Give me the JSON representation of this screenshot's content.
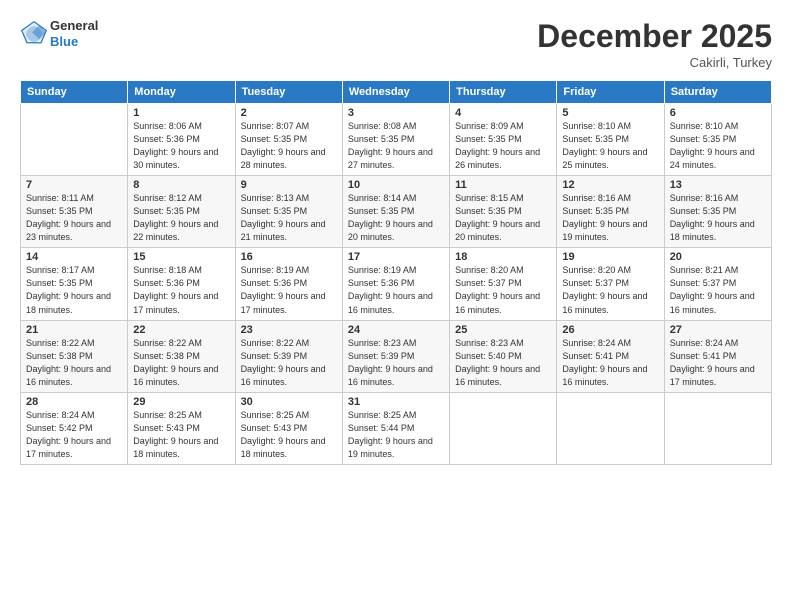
{
  "logo": {
    "general": "General",
    "blue": "Blue"
  },
  "header": {
    "month_year": "December 2025",
    "location": "Cakirli, Turkey"
  },
  "weekdays": [
    "Sunday",
    "Monday",
    "Tuesday",
    "Wednesday",
    "Thursday",
    "Friday",
    "Saturday"
  ],
  "weeks": [
    [
      {
        "day": "",
        "sunrise": "",
        "sunset": "",
        "daylight": ""
      },
      {
        "day": "1",
        "sunrise": "Sunrise: 8:06 AM",
        "sunset": "Sunset: 5:36 PM",
        "daylight": "Daylight: 9 hours and 30 minutes."
      },
      {
        "day": "2",
        "sunrise": "Sunrise: 8:07 AM",
        "sunset": "Sunset: 5:35 PM",
        "daylight": "Daylight: 9 hours and 28 minutes."
      },
      {
        "day": "3",
        "sunrise": "Sunrise: 8:08 AM",
        "sunset": "Sunset: 5:35 PM",
        "daylight": "Daylight: 9 hours and 27 minutes."
      },
      {
        "day": "4",
        "sunrise": "Sunrise: 8:09 AM",
        "sunset": "Sunset: 5:35 PM",
        "daylight": "Daylight: 9 hours and 26 minutes."
      },
      {
        "day": "5",
        "sunrise": "Sunrise: 8:10 AM",
        "sunset": "Sunset: 5:35 PM",
        "daylight": "Daylight: 9 hours and 25 minutes."
      },
      {
        "day": "6",
        "sunrise": "Sunrise: 8:10 AM",
        "sunset": "Sunset: 5:35 PM",
        "daylight": "Daylight: 9 hours and 24 minutes."
      }
    ],
    [
      {
        "day": "7",
        "sunrise": "Sunrise: 8:11 AM",
        "sunset": "Sunset: 5:35 PM",
        "daylight": "Daylight: 9 hours and 23 minutes."
      },
      {
        "day": "8",
        "sunrise": "Sunrise: 8:12 AM",
        "sunset": "Sunset: 5:35 PM",
        "daylight": "Daylight: 9 hours and 22 minutes."
      },
      {
        "day": "9",
        "sunrise": "Sunrise: 8:13 AM",
        "sunset": "Sunset: 5:35 PM",
        "daylight": "Daylight: 9 hours and 21 minutes."
      },
      {
        "day": "10",
        "sunrise": "Sunrise: 8:14 AM",
        "sunset": "Sunset: 5:35 PM",
        "daylight": "Daylight: 9 hours and 20 minutes."
      },
      {
        "day": "11",
        "sunrise": "Sunrise: 8:15 AM",
        "sunset": "Sunset: 5:35 PM",
        "daylight": "Daylight: 9 hours and 20 minutes."
      },
      {
        "day": "12",
        "sunrise": "Sunrise: 8:16 AM",
        "sunset": "Sunset: 5:35 PM",
        "daylight": "Daylight: 9 hours and 19 minutes."
      },
      {
        "day": "13",
        "sunrise": "Sunrise: 8:16 AM",
        "sunset": "Sunset: 5:35 PM",
        "daylight": "Daylight: 9 hours and 18 minutes."
      }
    ],
    [
      {
        "day": "14",
        "sunrise": "Sunrise: 8:17 AM",
        "sunset": "Sunset: 5:35 PM",
        "daylight": "Daylight: 9 hours and 18 minutes."
      },
      {
        "day": "15",
        "sunrise": "Sunrise: 8:18 AM",
        "sunset": "Sunset: 5:36 PM",
        "daylight": "Daylight: 9 hours and 17 minutes."
      },
      {
        "day": "16",
        "sunrise": "Sunrise: 8:19 AM",
        "sunset": "Sunset: 5:36 PM",
        "daylight": "Daylight: 9 hours and 17 minutes."
      },
      {
        "day": "17",
        "sunrise": "Sunrise: 8:19 AM",
        "sunset": "Sunset: 5:36 PM",
        "daylight": "Daylight: 9 hours and 16 minutes."
      },
      {
        "day": "18",
        "sunrise": "Sunrise: 8:20 AM",
        "sunset": "Sunset: 5:37 PM",
        "daylight": "Daylight: 9 hours and 16 minutes."
      },
      {
        "day": "19",
        "sunrise": "Sunrise: 8:20 AM",
        "sunset": "Sunset: 5:37 PM",
        "daylight": "Daylight: 9 hours and 16 minutes."
      },
      {
        "day": "20",
        "sunrise": "Sunrise: 8:21 AM",
        "sunset": "Sunset: 5:37 PM",
        "daylight": "Daylight: 9 hours and 16 minutes."
      }
    ],
    [
      {
        "day": "21",
        "sunrise": "Sunrise: 8:22 AM",
        "sunset": "Sunset: 5:38 PM",
        "daylight": "Daylight: 9 hours and 16 minutes."
      },
      {
        "day": "22",
        "sunrise": "Sunrise: 8:22 AM",
        "sunset": "Sunset: 5:38 PM",
        "daylight": "Daylight: 9 hours and 16 minutes."
      },
      {
        "day": "23",
        "sunrise": "Sunrise: 8:22 AM",
        "sunset": "Sunset: 5:39 PM",
        "daylight": "Daylight: 9 hours and 16 minutes."
      },
      {
        "day": "24",
        "sunrise": "Sunrise: 8:23 AM",
        "sunset": "Sunset: 5:39 PM",
        "daylight": "Daylight: 9 hours and 16 minutes."
      },
      {
        "day": "25",
        "sunrise": "Sunrise: 8:23 AM",
        "sunset": "Sunset: 5:40 PM",
        "daylight": "Daylight: 9 hours and 16 minutes."
      },
      {
        "day": "26",
        "sunrise": "Sunrise: 8:24 AM",
        "sunset": "Sunset: 5:41 PM",
        "daylight": "Daylight: 9 hours and 16 minutes."
      },
      {
        "day": "27",
        "sunrise": "Sunrise: 8:24 AM",
        "sunset": "Sunset: 5:41 PM",
        "daylight": "Daylight: 9 hours and 17 minutes."
      }
    ],
    [
      {
        "day": "28",
        "sunrise": "Sunrise: 8:24 AM",
        "sunset": "Sunset: 5:42 PM",
        "daylight": "Daylight: 9 hours and 17 minutes."
      },
      {
        "day": "29",
        "sunrise": "Sunrise: 8:25 AM",
        "sunset": "Sunset: 5:43 PM",
        "daylight": "Daylight: 9 hours and 18 minutes."
      },
      {
        "day": "30",
        "sunrise": "Sunrise: 8:25 AM",
        "sunset": "Sunset: 5:43 PM",
        "daylight": "Daylight: 9 hours and 18 minutes."
      },
      {
        "day": "31",
        "sunrise": "Sunrise: 8:25 AM",
        "sunset": "Sunset: 5:44 PM",
        "daylight": "Daylight: 9 hours and 19 minutes."
      },
      {
        "day": "",
        "sunrise": "",
        "sunset": "",
        "daylight": ""
      },
      {
        "day": "",
        "sunrise": "",
        "sunset": "",
        "daylight": ""
      },
      {
        "day": "",
        "sunrise": "",
        "sunset": "",
        "daylight": ""
      }
    ]
  ]
}
